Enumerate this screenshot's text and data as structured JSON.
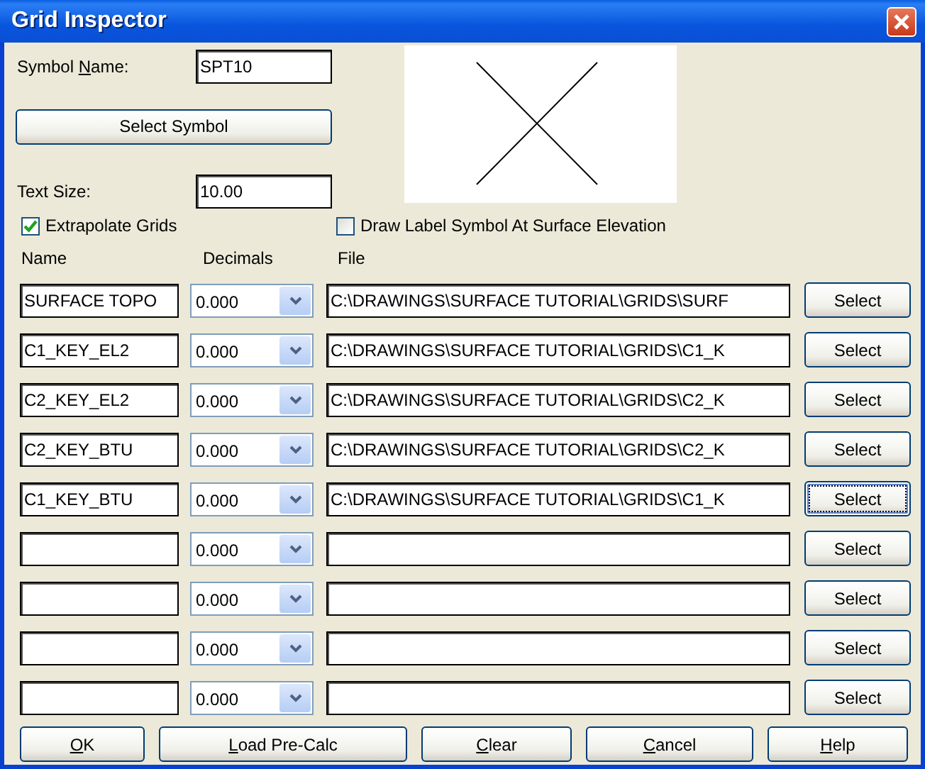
{
  "window": {
    "title": "Grid Inspector"
  },
  "symbol_name": {
    "label": {
      "before": "Symbol ",
      "mnemonic": "N",
      "after": "ame:"
    },
    "value": "SPT10"
  },
  "select_symbol_button": {
    "label": "Select Symbol"
  },
  "text_size": {
    "label": "Text Size:",
    "value": "10.00"
  },
  "options": [
    {
      "label": "Extrapolate Grids",
      "checked": true
    },
    {
      "label": "Draw Label Symbol At Surface Elevation",
      "checked": false
    }
  ],
  "columns": [
    "Name",
    "Decimals",
    "File"
  ],
  "grids": [
    {
      "name": "SURFACE TOPO",
      "decimals": "0.000",
      "file": "C:\\DRAWINGS\\SURFACE TUTORIAL\\GRIDS\\SURF",
      "button": "Select",
      "focused": false
    },
    {
      "name": "C1_KEY_EL2",
      "decimals": "0.000",
      "file": "C:\\DRAWINGS\\SURFACE TUTORIAL\\GRIDS\\C1_K",
      "button": "Select",
      "focused": false
    },
    {
      "name": "C2_KEY_EL2",
      "decimals": "0.000",
      "file": "C:\\DRAWINGS\\SURFACE TUTORIAL\\GRIDS\\C2_K",
      "button": "Select",
      "focused": false
    },
    {
      "name": "C2_KEY_BTU",
      "decimals": "0.000",
      "file": "C:\\DRAWINGS\\SURFACE TUTORIAL\\GRIDS\\C2_K",
      "button": "Select",
      "focused": false
    },
    {
      "name": "C1_KEY_BTU",
      "decimals": "0.000",
      "file": "C:\\DRAWINGS\\SURFACE TUTORIAL\\GRIDS\\C1_K",
      "button": "Select",
      "focused": true
    },
    {
      "decimals": "0.000",
      "button": "Select",
      "focused": false
    },
    {
      "decimals": "0.000",
      "button": "Select",
      "focused": false
    },
    {
      "decimals": "0.000",
      "button": "Select",
      "focused": false
    },
    {
      "decimals": "0.000",
      "button": "Select",
      "focused": false
    }
  ],
  "buttons": [
    {
      "mnemonic": "O",
      "after": "K"
    },
    {
      "mnemonic": "L",
      "after": "oad Pre-Calc"
    },
    {
      "mnemonic": "C",
      "after": "lear"
    },
    {
      "mnemonic": "C",
      "after": "ancel"
    },
    {
      "mnemonic": "H",
      "after": "elp"
    }
  ]
}
